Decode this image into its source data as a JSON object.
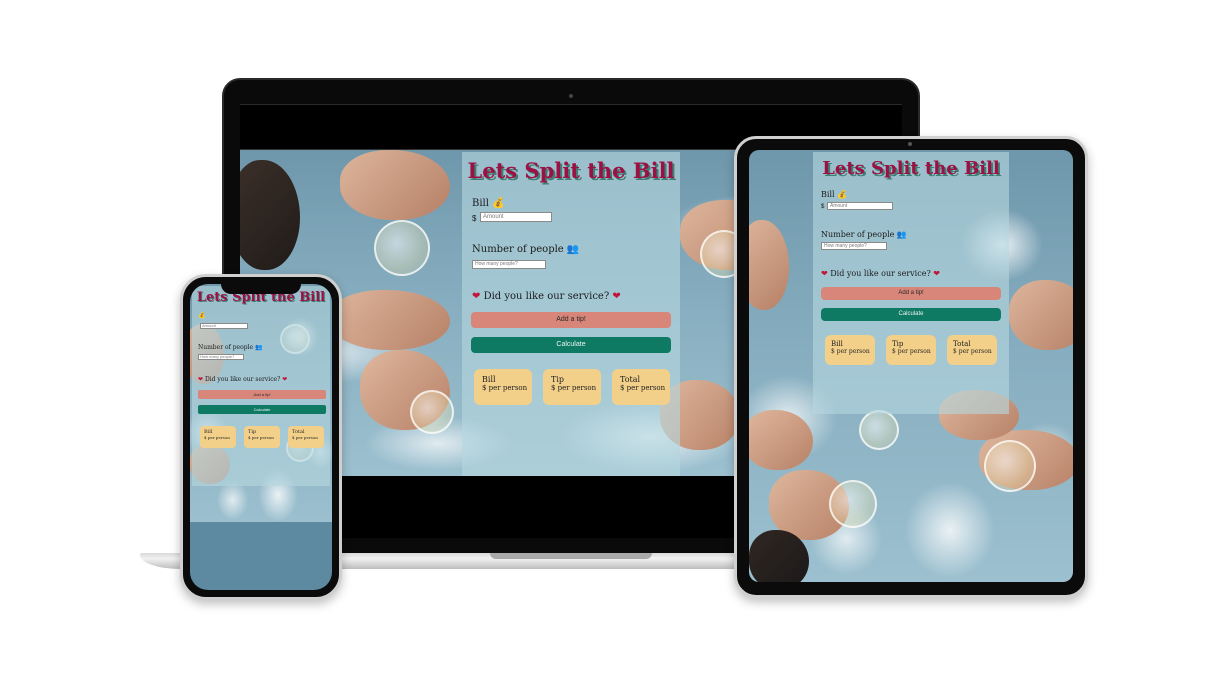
{
  "app": {
    "title": "Lets Split the Bill",
    "bill_label": "Bill",
    "bill_icon": "money-bag-icon",
    "currency_symbol": "$",
    "bill_placeholder": "Amount",
    "people_label": "Number of people",
    "people_icon": "people-icon",
    "people_placeholder": "How many people?",
    "service_question": "Did you like our service?",
    "service_icon": "heart-icon",
    "add_tip_label": "Add a tip!",
    "calculate_label": "Calculate",
    "results": [
      {
        "title": "Bill",
        "value": "$ per person"
      },
      {
        "title": "Tip",
        "value": "$ per person"
      },
      {
        "title": "Total",
        "value": "$ per person"
      }
    ]
  },
  "colors": {
    "title": "#9c1144",
    "title_shadow": "#3f7f73",
    "tip_button": "#d9867a",
    "calculate_button": "#0f7a64",
    "result_card": "#f3d08a",
    "card_overlay": "rgba(180,214,222,0.62)",
    "sky": "#86adbf"
  },
  "devices": [
    "laptop",
    "tablet",
    "phone"
  ]
}
